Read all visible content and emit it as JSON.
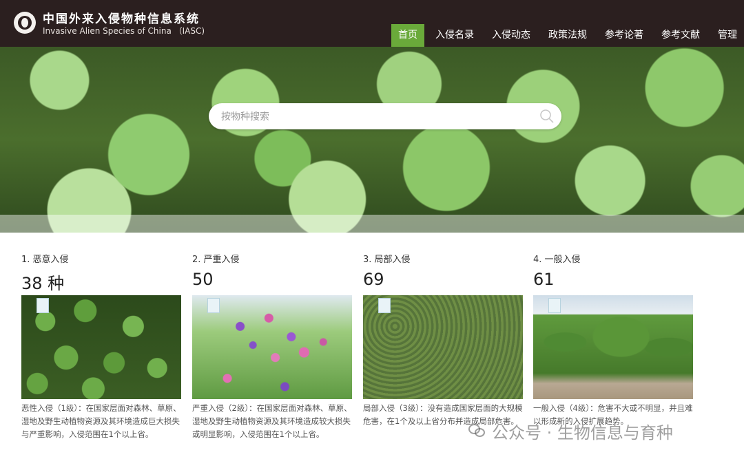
{
  "header": {
    "title_cn": "中国外来入侵物种信息系统",
    "title_en": "Invasive Alien Species of China （IASC)",
    "nav": [
      {
        "label": "首页",
        "active": true
      },
      {
        "label": "入侵名录",
        "active": false
      },
      {
        "label": "入侵动态",
        "active": false
      },
      {
        "label": "政策法规",
        "active": false
      },
      {
        "label": "参考论著",
        "active": false
      },
      {
        "label": "参考文献",
        "active": false
      },
      {
        "label": "管理",
        "active": false
      }
    ],
    "colors": {
      "background": "#2b1f1f",
      "nav_active": "#6aaa3a"
    }
  },
  "search": {
    "placeholder": "按物种搜索",
    "icon": "search-icon"
  },
  "categories": [
    {
      "title": "1. 恶意入侵",
      "count": "38 种",
      "description": "恶性入侵（1级）：在国家层面对森林、草原、湿地及野生动植物资源及其环境造成巨大损失与严重影响，入侵范围在1个以上省。"
    },
    {
      "title": "2. 严重入侵",
      "count": "50",
      "description": "严重入侵（2级）：在国家层面对森林、草原、湿地及野生动植物资源及其环境造成较大损失或明显影响，入侵范围在1个以上省。"
    },
    {
      "title": "3. 局部入侵",
      "count": "69",
      "description": "局部入侵（3级）：没有造成国家层面的大规模危害，在1个及以上省分布并造成局部危害。"
    },
    {
      "title": "4. 一般入侵",
      "count": "61",
      "description": "一般入侵（4级）：危害不大或不明显，并且难以形成新的入侵扩展趋势。"
    }
  ],
  "watermark": {
    "text": "公众号 · 生物信息与育种"
  }
}
